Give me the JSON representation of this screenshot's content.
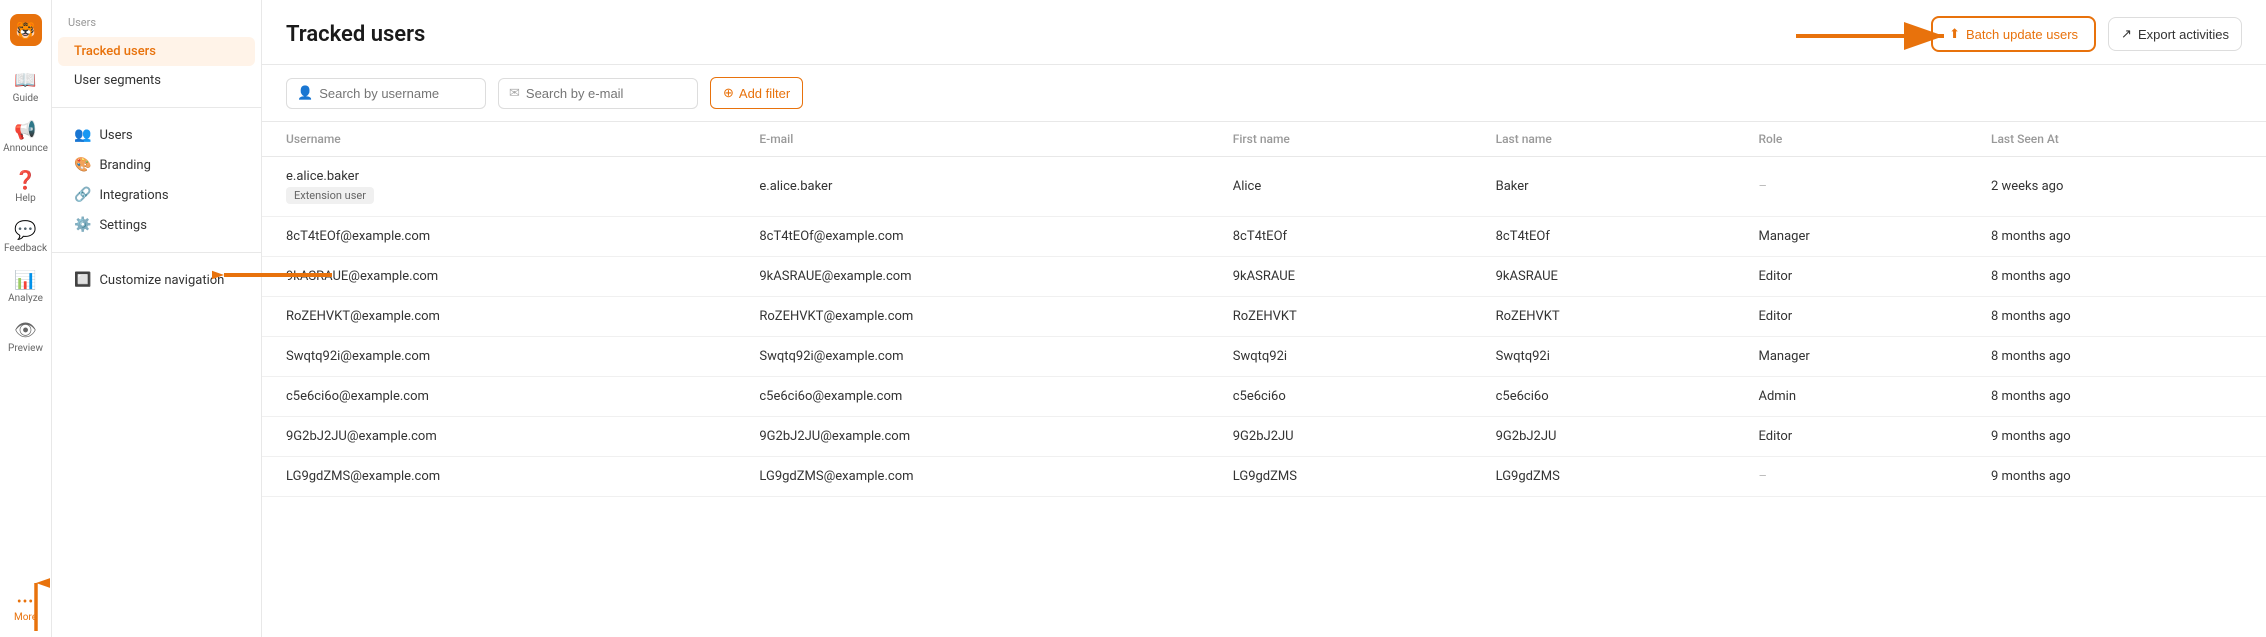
{
  "app": {
    "logo_icon": "🐯"
  },
  "icon_nav": {
    "items": [
      {
        "id": "guide",
        "label": "Guide",
        "icon": "📖"
      },
      {
        "id": "announce",
        "label": "Announce",
        "icon": "📢"
      },
      {
        "id": "help",
        "label": "Help",
        "icon": "❓"
      },
      {
        "id": "feedback",
        "label": "Feedback",
        "icon": "💬"
      },
      {
        "id": "analyze",
        "label": "Analyze",
        "icon": "📊"
      },
      {
        "id": "preview",
        "label": "Preview",
        "icon": "👁"
      },
      {
        "id": "more",
        "label": "More",
        "icon": "···"
      }
    ]
  },
  "sidebar": {
    "breadcrumb": "Users",
    "items": [
      {
        "id": "tracked-users",
        "label": "Tracked users",
        "active": true,
        "icon": "👤"
      },
      {
        "id": "user-segments",
        "label": "User segments",
        "active": false,
        "icon": ""
      }
    ],
    "more_items": [
      {
        "id": "users",
        "label": "Users",
        "icon": "👥"
      },
      {
        "id": "branding",
        "label": "Branding",
        "icon": "🎨"
      },
      {
        "id": "integrations",
        "label": "Integrations",
        "icon": "🔗"
      },
      {
        "id": "settings",
        "label": "Settings",
        "icon": "⚙️"
      }
    ],
    "customize_label": "Customize navigation",
    "customize_icon": "🔲"
  },
  "main": {
    "title": "Tracked users",
    "breadcrumb": "Users",
    "buttons": {
      "batch_update": "Batch update users",
      "export": "Export activities"
    },
    "filters": {
      "search_username_placeholder": "Search by username",
      "search_email_placeholder": "Search by e-mail",
      "add_filter": "Add filter"
    },
    "table": {
      "columns": [
        "Username",
        "E-mail",
        "First name",
        "Last name",
        "Role",
        "Last Seen At"
      ],
      "rows": [
        {
          "username": "e.alice.baker",
          "tag": "Extension user",
          "email": "e.alice.baker",
          "first_name": "Alice",
          "last_name": "Baker",
          "role": "–",
          "last_seen": "2 weeks ago"
        },
        {
          "username": "8cT4tEOf@example.com",
          "tag": "",
          "email": "8cT4tEOf@example.com",
          "first_name": "8cT4tEOf",
          "last_name": "8cT4tEOf",
          "role": "Manager",
          "last_seen": "8 months ago"
        },
        {
          "username": "9kASRAUE@example.com",
          "tag": "",
          "email": "9kASRAUE@example.com",
          "first_name": "9kASRAUE",
          "last_name": "9kASRAUE",
          "role": "Editor",
          "last_seen": "8 months ago"
        },
        {
          "username": "RoZEHVKT@example.com",
          "tag": "",
          "email": "RoZEHVKT@example.com",
          "first_name": "RoZEHVKT",
          "last_name": "RoZEHVKT",
          "role": "Editor",
          "last_seen": "8 months ago"
        },
        {
          "username": "Swqtq92i@example.com",
          "tag": "",
          "email": "Swqtq92i@example.com",
          "first_name": "Swqtq92i",
          "last_name": "Swqtq92i",
          "role": "Manager",
          "last_seen": "8 months ago"
        },
        {
          "username": "c5e6ci6o@example.com",
          "tag": "",
          "email": "c5e6ci6o@example.com",
          "first_name": "c5e6ci6o",
          "last_name": "c5e6ci6o",
          "role": "Admin",
          "last_seen": "8 months ago"
        },
        {
          "username": "9G2bJ2JU@example.com",
          "tag": "",
          "email": "9G2bJ2JU@example.com",
          "first_name": "9G2bJ2JU",
          "last_name": "9G2bJ2JU",
          "role": "Editor",
          "last_seen": "9 months ago"
        },
        {
          "username": "LG9gdZMS@example.com",
          "tag": "",
          "email": "LG9gdZMS@example.com",
          "first_name": "LG9gdZMS",
          "last_name": "LG9gdZMS",
          "role": "–",
          "last_seen": "9 months ago"
        }
      ]
    }
  }
}
